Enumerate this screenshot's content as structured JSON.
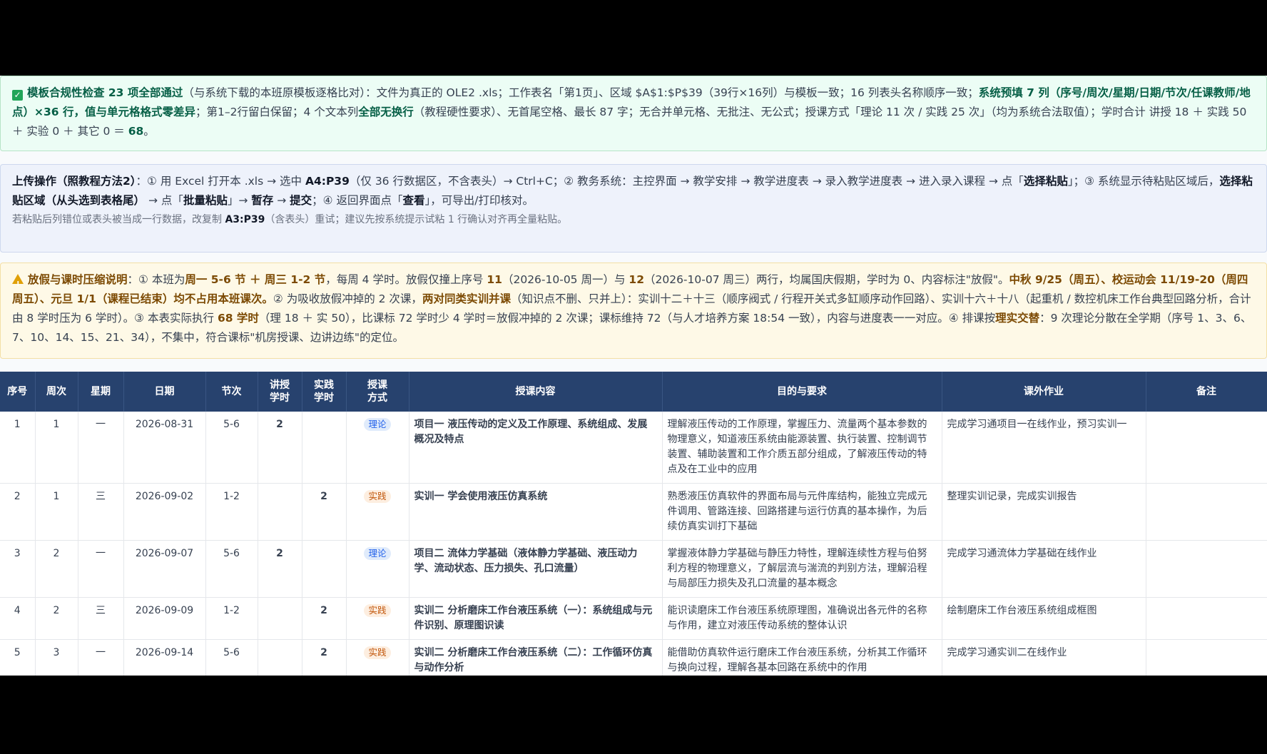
{
  "compliance": {
    "title": "模板合规性检查 23 项全部通过",
    "text1": "（与系统下载的本班原模板逐格比对）：文件为真正的 OLE2 .xls；工作表名「第1页」、区域 $A$1:$P$39（39行×16列）与模板一致；16 列表头名称顺序一致；",
    "bold2": "系统预填 7 列（序号/周次/星期/日期/节次/任课教师/地点）×36 行，值与单元格格式零差异",
    "text2": "；第1–2行留白保留；4 个文本列",
    "bold3": "全部无换行",
    "text3": "（教程硬性要求）、无首尾空格、最长 87 字；无合并单元格、无批注、无公式；授课方式「理论 11 次 / 实践 25 次」（均为系统合法取值）；学时合计 讲授 18 ＋ 实践 50 ＋ 实验 0 ＋ 其它 0 ＝ ",
    "total": "68",
    "end": "。"
  },
  "upload": {
    "title": "上传操作（照教程方法2）",
    "t1": "：① 用 Excel 打开本 .xls → 选中 ",
    "b1": "A4:P39",
    "t2": "（仅 36 行数据区，不含表头）→ Ctrl+C；② 教务系统：主控界面 → 教学安排 → 教学进度表 → 录入教学进度表 → 进入录入课程 → 点「",
    "b2": "选择粘贴",
    "t3": "」；③ 系统显示待粘贴区域后，",
    "b3": "选择粘贴区域（从头选到表格尾）",
    "t4": " → 点「",
    "b4": "批量粘贴",
    "t5": "」→ ",
    "b5": "暂存",
    "t6": " → ",
    "b6": "提交",
    "t7": "；④ 返回界面点「",
    "b7": "查看",
    "t8": "」，可导出/打印核对。",
    "note1": "若粘贴后列错位或表头被当成一行数据，改复制 ",
    "note_b": "A3:P39",
    "note2": "（含表头）重试；建议先按系统提示试粘 1 行确认对齐再全量粘贴。"
  },
  "holiday": {
    "title": "放假与课时压缩说明",
    "t1": "：① 本班为",
    "b1": "周一 5-6 节 ＋ 周三 1-2 节",
    "t2": "，每周 4 学时。放假仅撞上序号 ",
    "b2": "11",
    "t3": "（2026-10-05 周一）与 ",
    "b3": "12",
    "t4": "（2026-10-07 周三）两行，均属国庆假期，学时为 0、内容标注\"放假\"。",
    "b4": "中秋 9/25（周五）、校运动会 11/19-20（周四周五）、元旦 1/1（课程已结束）均不占用本班课次。",
    "t5": "② 为吸收放假冲掉的 2 次课，",
    "b5": "两对同类实训并课",
    "t6": "（知识点不删、只并上）：实训十二＋十三（顺序阀式 / 行程开关式多缸顺序动作回路）、实训十六＋十八（起重机 / 数控机床工作台典型回路分析，合计由 8 学时压为 6 学时）。③ 本表实际执行 ",
    "b6": "68 学时",
    "t7": "（理 18 ＋ 实 50），比课标 72 学时少 4 学时＝放假冲掉的 2 次课；课标维持 72（与人才培养方案 18:54 一致），内容与进度表一一对应。④ 排课按",
    "b7": "理实交替",
    "t8": "：9 次理论分散在全学期（序号 1、3、6、7、10、14、15、21、34），不集中，符合课标\"机房授课、边讲边练\"的定位。"
  },
  "table": {
    "headers": [
      "序号",
      "周次",
      "星期",
      "日期",
      "节次",
      "讲授\n学时",
      "实践\n学时",
      "授课\n方式",
      "授课内容",
      "目的与要求",
      "课外作业",
      "备注"
    ],
    "rows": [
      {
        "no": "1",
        "week": "1",
        "day": "一",
        "date": "2026-08-31",
        "period": "5-6",
        "lec": "2",
        "prac": "",
        "mode": "理论",
        "content": "项目一 液压传动的定义及工作原理、系统组成、发展概况及特点",
        "goal": "理解液压传动的工作原理，掌握压力、流量两个基本参数的物理意义，知道液压系统由能源装置、执行装置、控制调节装置、辅助装置和工作介质五部分组成，了解液压传动的特点及在工业中的应用",
        "hw": "完成学习通项目一在线作业，预习实训一",
        "remark": ""
      },
      {
        "no": "2",
        "week": "1",
        "day": "三",
        "date": "2026-09-02",
        "period": "1-2",
        "lec": "",
        "prac": "2",
        "mode": "实践",
        "content": "实训一 学会使用液压仿真系统",
        "goal": "熟悉液压仿真软件的界面布局与元件库结构，能独立完成元件调用、管路连接、回路搭建与运行仿真的基本操作，为后续仿真实训打下基础",
        "hw": "整理实训记录，完成实训报告",
        "remark": ""
      },
      {
        "no": "3",
        "week": "2",
        "day": "一",
        "date": "2026-09-07",
        "period": "5-6",
        "lec": "2",
        "prac": "",
        "mode": "理论",
        "content": "项目二 流体力学基础（液体静力学基础、液压动力学、流动状态、压力损失、孔口流量）",
        "goal": "掌握液体静力学基础与静压力特性，理解连续性方程与伯努利方程的物理意义，了解层流与湍流的判别方法，理解沿程与局部压力损失及孔口流量的基本概念",
        "hw": "完成学习通流体力学基础在线作业",
        "remark": ""
      },
      {
        "no": "4",
        "week": "2",
        "day": "三",
        "date": "2026-09-09",
        "period": "1-2",
        "lec": "",
        "prac": "2",
        "mode": "实践",
        "content": "实训二 分析磨床工作台液压系统（一）：系统组成与元件识别、原理图识读",
        "goal": "能识读磨床工作台液压系统原理图，准确说出各元件的名称与作用，建立对液压传动系统的整体认识",
        "hw": "绘制磨床工作台液压系统组成框图",
        "remark": ""
      },
      {
        "no": "5",
        "week": "3",
        "day": "一",
        "date": "2026-09-14",
        "period": "5-6",
        "lec": "",
        "prac": "2",
        "mode": "实践",
        "content": "实训二 分析磨床工作台液压系统（二）：工作循环仿真与动作分析",
        "goal": "能借助仿真软件运行磨床工作台液压系统，分析其工作循环与换向过程，理解各基本回路在系统中的作用",
        "hw": "完成学习通实训二在线作业",
        "remark": ""
      }
    ]
  },
  "colors": {
    "header_bg": "#27426e",
    "theory_badge": "#2563eb",
    "practice_badge": "#c2570c"
  }
}
